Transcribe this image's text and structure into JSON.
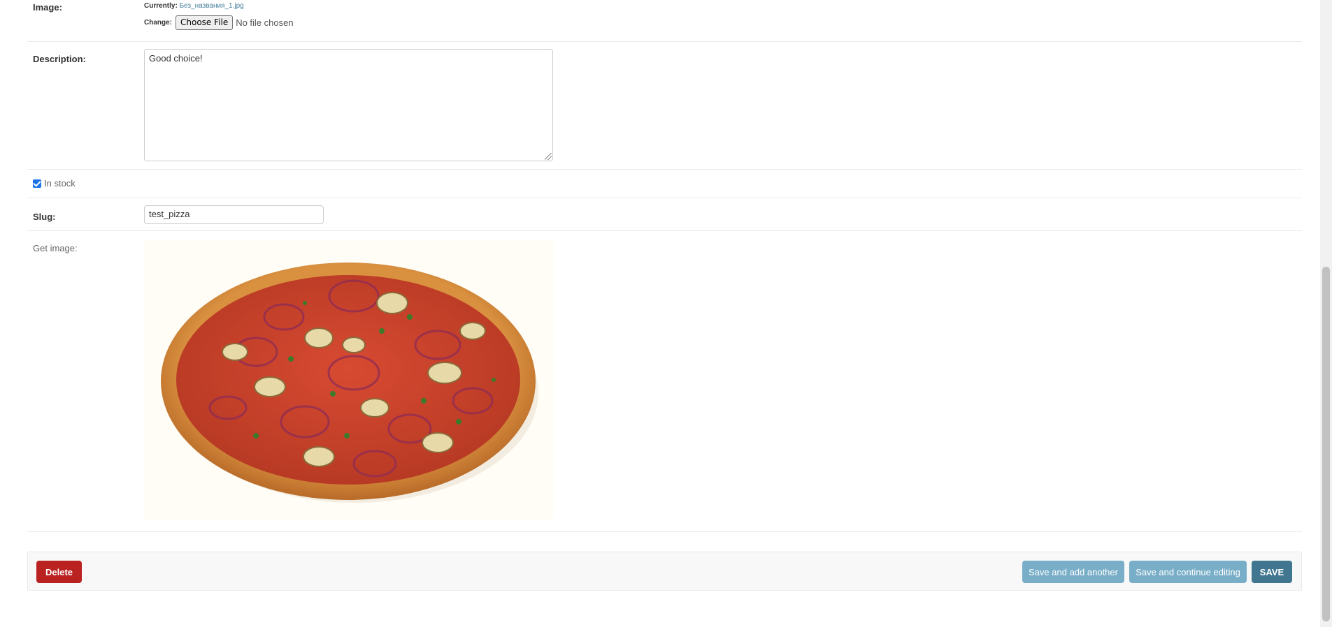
{
  "form": {
    "image": {
      "label": "Image:",
      "currently_label": "Currently:",
      "current_file": "Без_названия_1.jpg",
      "change_label": "Change:",
      "choose_file_button": "Choose File",
      "no_file_text": "No file chosen"
    },
    "description": {
      "label": "Description:",
      "value": "Good choice!"
    },
    "in_stock": {
      "label": "In stock",
      "checked": true
    },
    "slug": {
      "label": "Slug:",
      "value": "test_pizza"
    },
    "get_image": {
      "label": "Get image:"
    }
  },
  "submit_row": {
    "delete_label": "Delete",
    "save_add_another_label": "Save and add another",
    "save_continue_label": "Save and continue editing",
    "save_label": "SAVE"
  },
  "colors": {
    "delete": "#ba2121",
    "secondary_button": "#79aec8",
    "primary_button": "#417690",
    "link": "#447e9b"
  }
}
